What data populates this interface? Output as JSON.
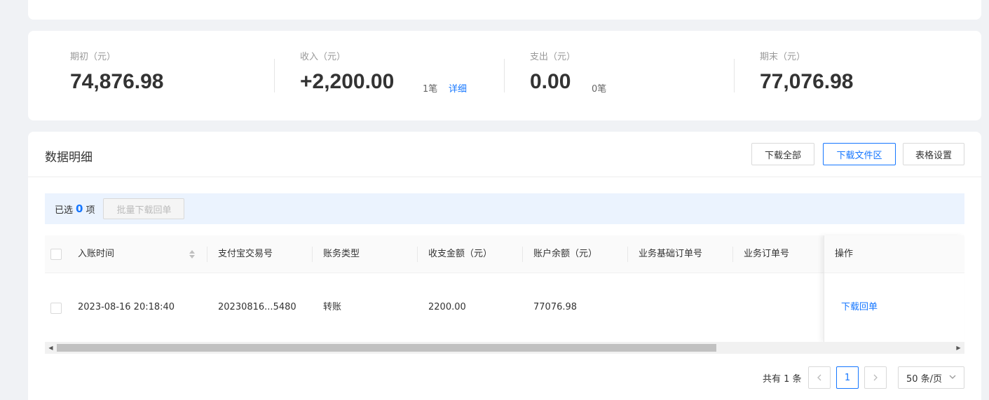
{
  "summary": {
    "opening": {
      "label": "期初（元）",
      "value": "74,876.98"
    },
    "income": {
      "label": "收入（元）",
      "value": "+2,200.00",
      "count": "1笔",
      "detail_link": "详细"
    },
    "expense": {
      "label": "支出（元）",
      "value": "0.00",
      "count": "0笔"
    },
    "closing": {
      "label": "期末（元）",
      "value": "77,076.98"
    }
  },
  "details": {
    "title": "数据明细",
    "buttons": {
      "download_all": "下载全部",
      "download_area": "下载文件区",
      "table_settings": "表格设置"
    },
    "selection": {
      "prefix": "已选",
      "count": "0",
      "suffix": "项",
      "batch_button": "批量下载回单"
    },
    "table": {
      "columns": [
        "入账时间",
        "支付宝交易号",
        "账务类型",
        "收支金额（元）",
        "账户余额（元）",
        "业务基础订单号",
        "业务订单号",
        "操作"
      ],
      "rows": [
        {
          "time": "2023-08-16 20:18:40",
          "trade_no": "20230816...5480",
          "type": "转账",
          "amount": "2200.00",
          "balance": "77076.98",
          "base_order": "",
          "order": "",
          "action": "下载回单"
        }
      ]
    },
    "pagination": {
      "total": "共有 1 条",
      "current_page": "1",
      "page_size": "50 条/页"
    }
  }
}
